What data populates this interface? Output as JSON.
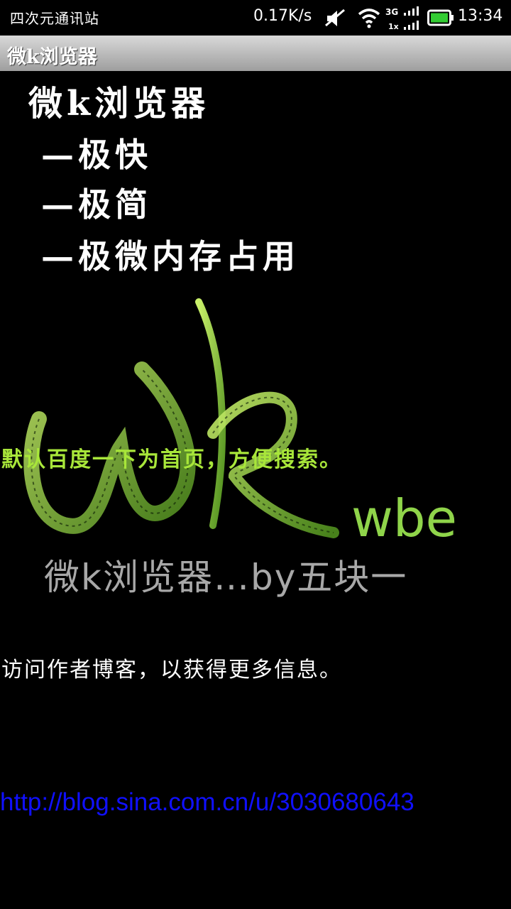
{
  "status_bar": {
    "carrier": "四次元通讯站",
    "net_speed": "0.17K/s",
    "network_types": [
      "3G",
      "1x"
    ],
    "time": "13:34",
    "icons": [
      "mute-icon",
      "wifi-icon",
      "signal-icon",
      "battery-icon"
    ],
    "battery_color": "#33cc33"
  },
  "app_bar": {
    "title": "微k浏览器"
  },
  "splash": {
    "heading": "微k浏览器",
    "features": [
      "—极快",
      "—极简",
      "—极微内存占用"
    ],
    "logo_letters": "wk",
    "logo_small": "wbe",
    "logo_caption": "微k浏览器…by五块一",
    "accent_green": "#8fd44a"
  },
  "hints": {
    "homepage": "默认百度一下为首页，方便搜索。",
    "visit_blog": "访问作者博客，以获得更多信息。"
  },
  "link": {
    "url_text": "http://blog.sina.com.cn/u/3030680643",
    "color": "#1010ff"
  }
}
